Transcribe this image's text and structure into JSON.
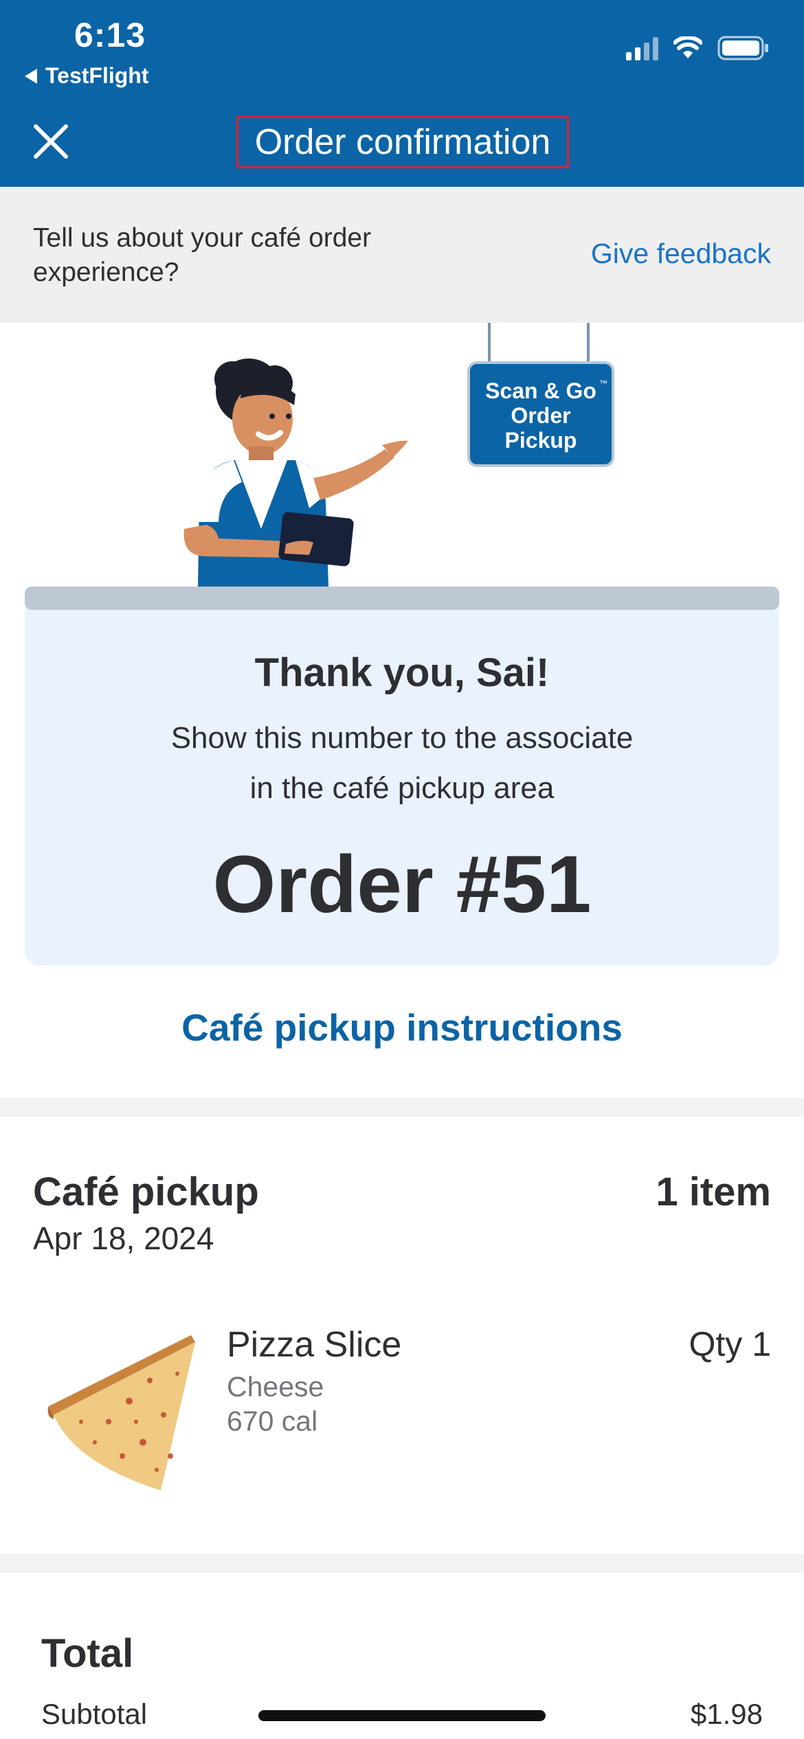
{
  "status_bar": {
    "time": "6:13",
    "back_app": "TestFlight"
  },
  "header": {
    "title": "Order confirmation",
    "close_icon": "close-icon"
  },
  "feedback": {
    "prompt": "Tell us about your café order experience?",
    "link": "Give feedback"
  },
  "illustration": {
    "sign_line1": "Scan & Go",
    "sign_tm": "™",
    "sign_line2": "Order",
    "sign_line3": "Pickup"
  },
  "confirmation": {
    "thank_you": "Thank you, Sai!",
    "instruction_line1": "Show this number to the associate",
    "instruction_line2": "in the café pickup area",
    "order_number": "Order #51"
  },
  "pickup_instructions_link": "Café pickup instructions",
  "pickup": {
    "title": "Café pickup",
    "date": "Apr 18, 2024",
    "item_count": "1 item",
    "items": [
      {
        "name": "Pizza Slice",
        "option": "Cheese",
        "calories": "670 cal",
        "quantity": "Qty 1"
      }
    ]
  },
  "total": {
    "title": "Total",
    "subtotal_label": "Subtotal",
    "subtotal_value": "$1.98"
  },
  "colors": {
    "brand_blue": "#0b64a6",
    "link_blue": "#1a73c8",
    "card_bg": "#eaf2fd",
    "highlight_red": "#e2202b"
  }
}
